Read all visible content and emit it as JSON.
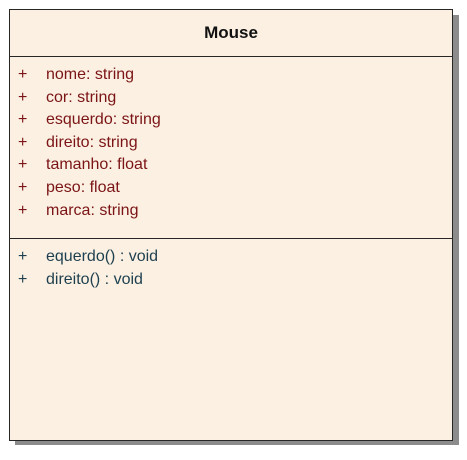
{
  "class": {
    "name": "Mouse",
    "attributes": [
      {
        "visibility": "+",
        "text": "nome:  string"
      },
      {
        "visibility": "+",
        "text": "cor:  string"
      },
      {
        "visibility": "+",
        "text": "esquerdo:  string"
      },
      {
        "visibility": "+",
        "text": "direito:  string"
      },
      {
        "visibility": "+",
        "text": "tamanho:  float"
      },
      {
        "visibility": "+",
        "text": "peso:  float"
      },
      {
        "visibility": "+",
        "text": "marca:  string"
      }
    ],
    "operations": [
      {
        "visibility": "+",
        "text": "equerdo() : void"
      },
      {
        "visibility": "+",
        "text": "direito() : void"
      }
    ]
  },
  "colors": {
    "box_fill": "#fbf0e1",
    "border": "#262626",
    "shadow": "#8c8c8c",
    "attribute_text": "#7b1416",
    "operation_text": "#1d3f4f"
  }
}
